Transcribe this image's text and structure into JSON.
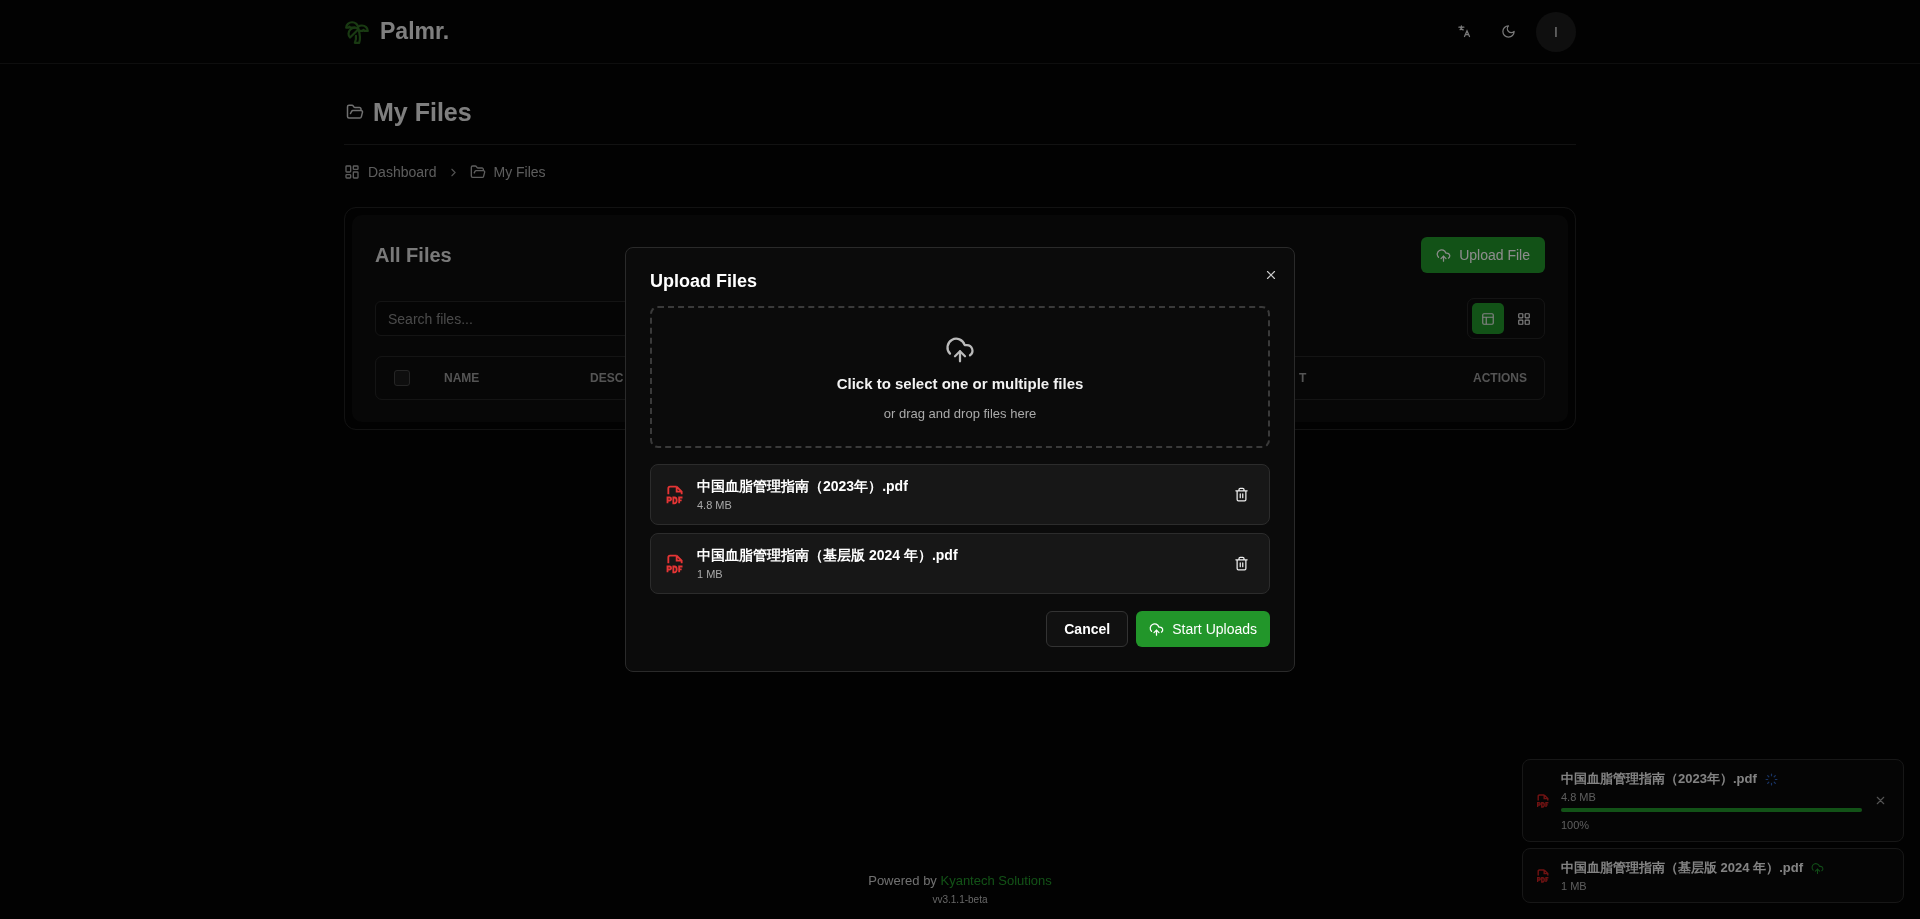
{
  "header": {
    "brand": "Palmr.",
    "avatar_initial": "I"
  },
  "page": {
    "title": "My Files",
    "breadcrumb": [
      {
        "label": "Dashboard",
        "kind": "dashboard"
      },
      {
        "label": "My Files",
        "kind": "folder"
      }
    ]
  },
  "files_card": {
    "title": "All Files",
    "upload_button": "Upload File",
    "search": {
      "placeholder": "Search files..."
    },
    "view_modes": [
      {
        "kind": "table",
        "selected": true
      },
      {
        "kind": "grid",
        "selected": false
      }
    ],
    "table": {
      "select_all_checked": false,
      "columns": [
        "NAME",
        "DESC",
        "T",
        "ACTIONS"
      ]
    }
  },
  "modal": {
    "title": "Upload Files",
    "dropzone": {
      "title": "Click to select one or multiple files",
      "hint": "or drag and drop files here"
    },
    "files": [
      {
        "name": "中国血脂管理指南（2023年）.pdf",
        "size": "4.8 MB"
      },
      {
        "name": "中国血脂管理指南（基层版 2024 年）.pdf",
        "size": "1 MB"
      }
    ],
    "buttons": {
      "cancel": "Cancel",
      "submit": "Start Uploads"
    }
  },
  "toasts": [
    {
      "name": "中国血脂管理指南（2023年）.pdf",
      "kind": "uploading",
      "size": "4.8 MB",
      "level": 1,
      "reading": "100%"
    },
    {
      "name": "中国血脂管理指南（基层版 2024 年）.pdf",
      "kind": "pending",
      "size": "1 MB"
    }
  ],
  "footer": {
    "prefix": "Powered by",
    "link": "Kyantech Solutions",
    "version": "vv3.1.1-beta"
  }
}
